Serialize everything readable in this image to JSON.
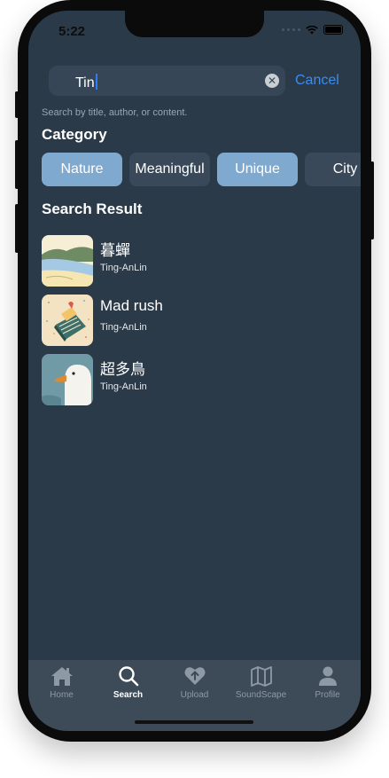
{
  "status_bar": {
    "time": "5:22"
  },
  "search": {
    "value": "Tin",
    "cancel_label": "Cancel",
    "hint": "Search by title, author, or content."
  },
  "category": {
    "title": "Category",
    "chips": [
      {
        "label": "Nature",
        "selected": true
      },
      {
        "label": "Meaningful",
        "selected": false
      },
      {
        "label": "Unique",
        "selected": true
      },
      {
        "label": "City",
        "selected": false
      }
    ]
  },
  "results": {
    "title": "Search Result",
    "items": [
      {
        "title": "暮蟬",
        "author": "Ting-AnLin"
      },
      {
        "title": "Mad rush",
        "author": "Ting-AnLin"
      },
      {
        "title": "超多鳥",
        "author": "Ting-AnLin"
      }
    ]
  },
  "tabbar": {
    "items": [
      {
        "label": "Home",
        "icon": "home-icon"
      },
      {
        "label": "Search",
        "icon": "search-icon",
        "active": true
      },
      {
        "label": "Upload",
        "icon": "upload-heart-icon"
      },
      {
        "label": "SoundScape",
        "icon": "map-icon"
      },
      {
        "label": "Profile",
        "icon": "person-icon"
      }
    ]
  },
  "colors": {
    "background": "#2b3a48",
    "chip_selected": "#7fa9cf",
    "chip_unselected": "#3a4959",
    "accent": "#3b8cf1",
    "tabbar": "#3d4b59"
  }
}
